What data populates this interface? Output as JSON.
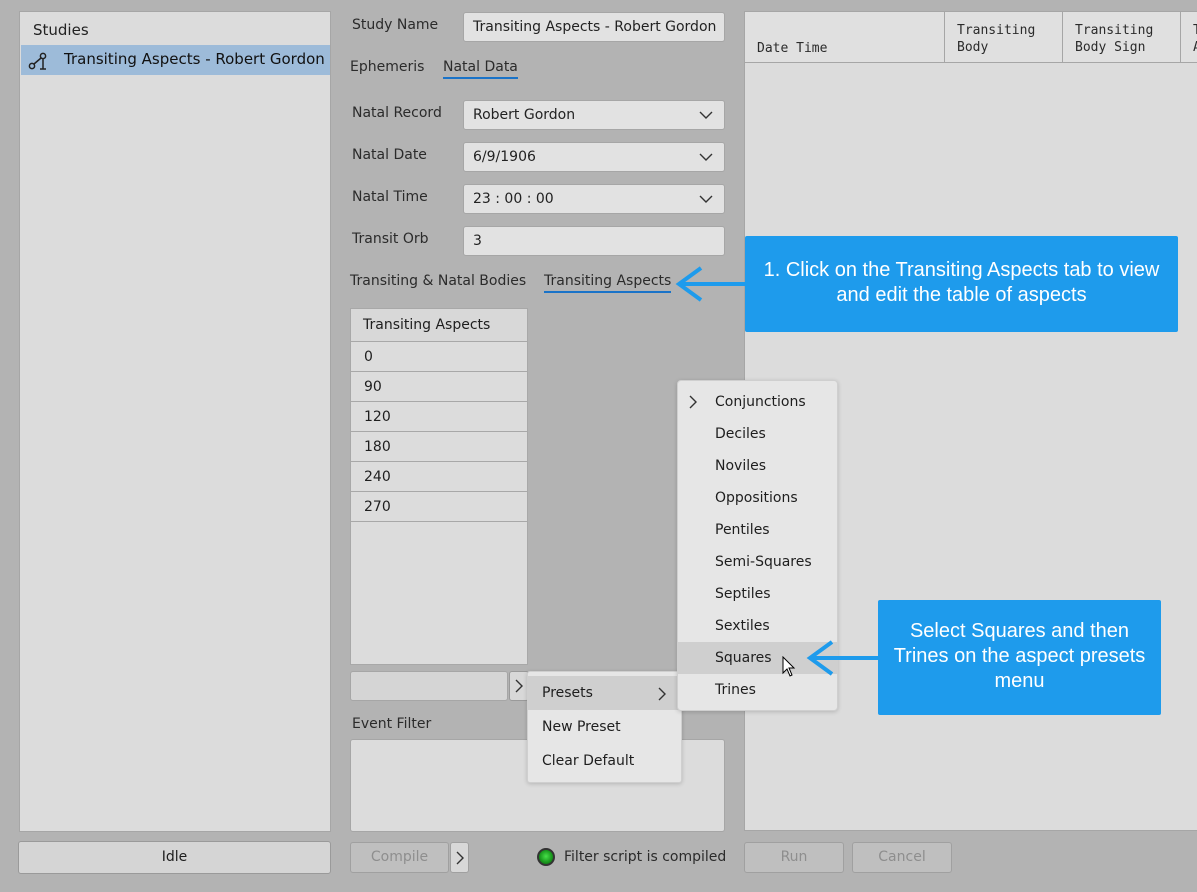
{
  "studies": {
    "header": "Studies",
    "items": [
      {
        "label": "Transiting Aspects - Robert Gordon",
        "icon": "transit-study-icon"
      }
    ],
    "status": "Idle"
  },
  "form": {
    "study_name_label": "Study Name",
    "study_name_value": "Transiting Aspects - Robert Gordon",
    "tabs": [
      "Ephemeris",
      "Natal Data"
    ],
    "natal_record_label": "Natal Record",
    "natal_record_value": "Robert Gordon",
    "natal_date_label": "Natal Date",
    "natal_date_value": "6/9/1906",
    "natal_time_label": "Natal Time",
    "natal_time_value": "23 : 00 : 00",
    "transit_orb_label": "Transit Orb",
    "transit_orb_value": "3",
    "subtabs": [
      "Transiting & Natal Bodies",
      "Transiting Aspects"
    ]
  },
  "aspects_table": {
    "header": "Transiting Aspects",
    "rows": [
      "0",
      "90",
      "120",
      "180",
      "240",
      "270"
    ]
  },
  "event_filter": {
    "label": "Event Filter"
  },
  "bottom": {
    "compile_label": "Compile",
    "filter_status": "Filter script is compiled",
    "run_label": "Run",
    "cancel_label": "Cancel"
  },
  "results_grid": {
    "columns": [
      {
        "line1": "Date Time",
        "line2": ""
      },
      {
        "line1": "Transiting",
        "line2": "Body"
      },
      {
        "line1": "Transiting",
        "line2": "Body Sign"
      },
      {
        "line1": "T",
        "line2": "A"
      }
    ]
  },
  "presets_menu": {
    "items": [
      "Presets",
      "New Preset",
      "Clear Default"
    ]
  },
  "aspect_presets_menu": {
    "items": [
      "Conjunctions",
      "Deciles",
      "Noviles",
      "Oppositions",
      "Pentiles",
      "Semi-Squares",
      "Septiles",
      "Sextiles",
      "Squares",
      "Trines"
    ],
    "highlighted": "Squares"
  },
  "callouts": {
    "tab_hint": "1. Click on the Transiting Aspects tab to view and edit the table of aspects",
    "squares_hint": "Select Squares and then Trines on the aspect presets menu"
  },
  "colors": {
    "accent_blue": "#1e9bec",
    "tab_underline": "#1a73c8",
    "selected_row": "#9dbbd9",
    "status_green": "#2ec232"
  }
}
